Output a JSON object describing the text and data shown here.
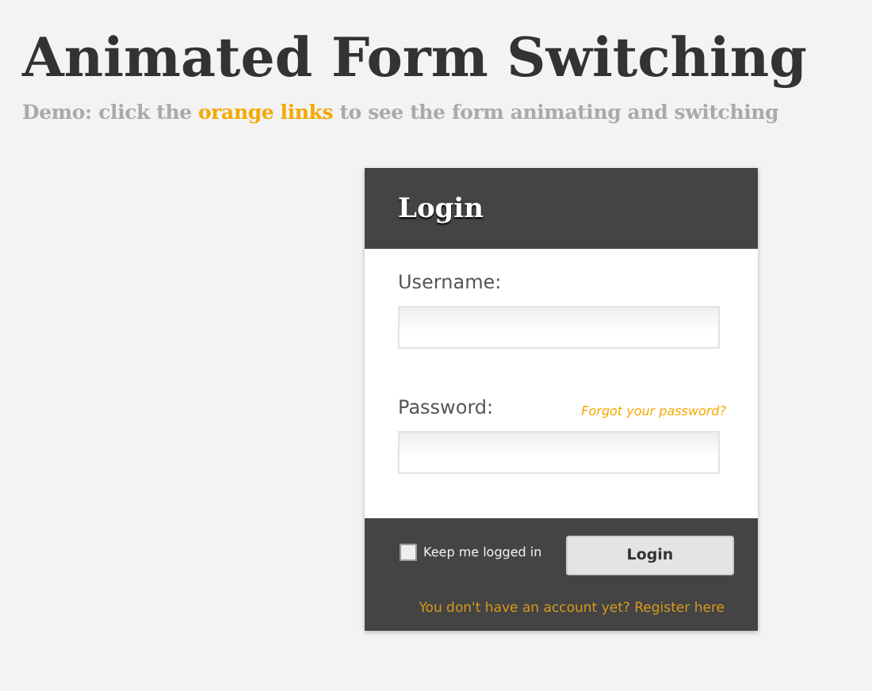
{
  "page": {
    "title": "Animated Form Switching",
    "subtitle": {
      "before": "Demo: click the",
      "link": "orange links",
      "after": "to see the form animating and switching"
    }
  },
  "login_form": {
    "title": "Login",
    "fields": [
      {
        "label": "Username:"
      },
      {
        "label": "Password:",
        "side_link": "Forgot your password?"
      }
    ],
    "remember": {
      "label": "Keep me logged in",
      "checked": false
    },
    "submit": "Login",
    "register_link": "You don't have an account yet? Register here"
  }
}
